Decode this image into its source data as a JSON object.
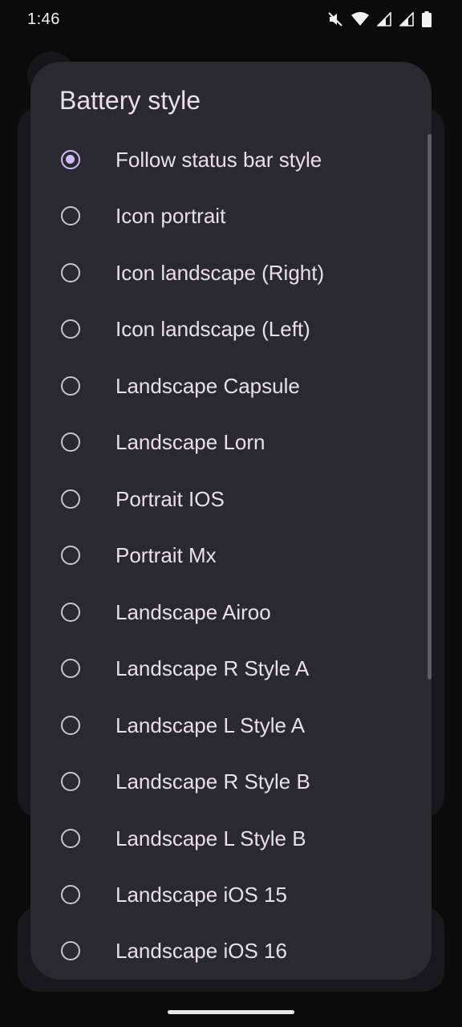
{
  "status_bar": {
    "time": "1:46",
    "icons": [
      "mute-icon",
      "wifi-icon",
      "signal-icon",
      "signal-icon",
      "battery-icon"
    ]
  },
  "dialog": {
    "title": "Battery style",
    "selected_index": 0,
    "options": [
      "Follow status bar style",
      "Icon portrait",
      "Icon landscape (Right)",
      "Icon landscape (Left)",
      "Landscape Capsule",
      "Landscape Lorn",
      "Portrait IOS",
      "Portrait Mx",
      "Landscape Airoo",
      "Landscape R Style A",
      "Landscape L Style A",
      "Landscape R Style B",
      "Landscape L Style B",
      "Landscape iOS 15",
      "Landscape iOS 16"
    ]
  },
  "colors": {
    "dialog_bg": "#2b2930",
    "accent": "#cfbcff",
    "text": "#e6e1e6"
  }
}
